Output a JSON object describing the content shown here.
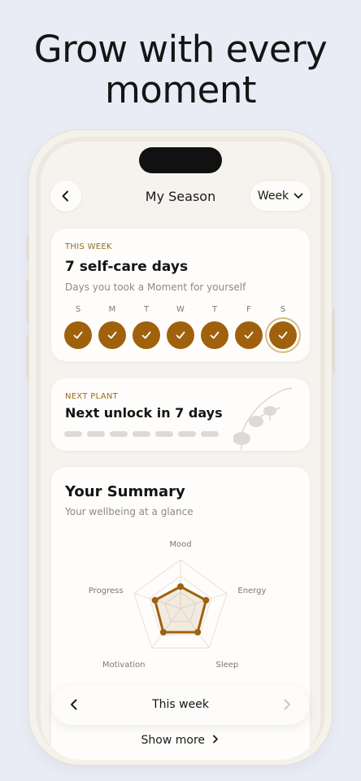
{
  "headline": {
    "line1": "Grow with every",
    "line2": "moment"
  },
  "nav": {
    "title": "My Season",
    "range_label": "Week"
  },
  "this_week": {
    "eyebrow": "THIS WEEK",
    "title": "7 self-care days",
    "subtitle": "Days you took a Moment for yourself",
    "days": [
      {
        "letter": "S",
        "done": true
      },
      {
        "letter": "M",
        "done": true
      },
      {
        "letter": "T",
        "done": true
      },
      {
        "letter": "W",
        "done": true
      },
      {
        "letter": "T",
        "done": true
      },
      {
        "letter": "F",
        "done": true
      },
      {
        "letter": "S",
        "done": true,
        "today": true
      }
    ]
  },
  "next_plant": {
    "eyebrow": "NEXT PLANT",
    "title": "Next unlock in 7 days",
    "days_remaining": 7,
    "segments": 7
  },
  "summary": {
    "title": "Your Summary",
    "subtitle": "Your wellbeing at a glance",
    "chart_data": {
      "type": "radar",
      "axes": [
        "Mood",
        "Energy",
        "Sleep",
        "Motivation",
        "Progress"
      ],
      "values": [
        0.45,
        0.55,
        0.6,
        0.6,
        0.55
      ],
      "range": [
        0,
        1
      ],
      "grid_levels": 3,
      "color": "#a0610d"
    }
  },
  "footer": {
    "period_label": "This week",
    "show_more": "Show more"
  },
  "colors": {
    "accent": "#a0610d",
    "eyebrow": "#9a6a17",
    "background": "#e9ecf4"
  }
}
